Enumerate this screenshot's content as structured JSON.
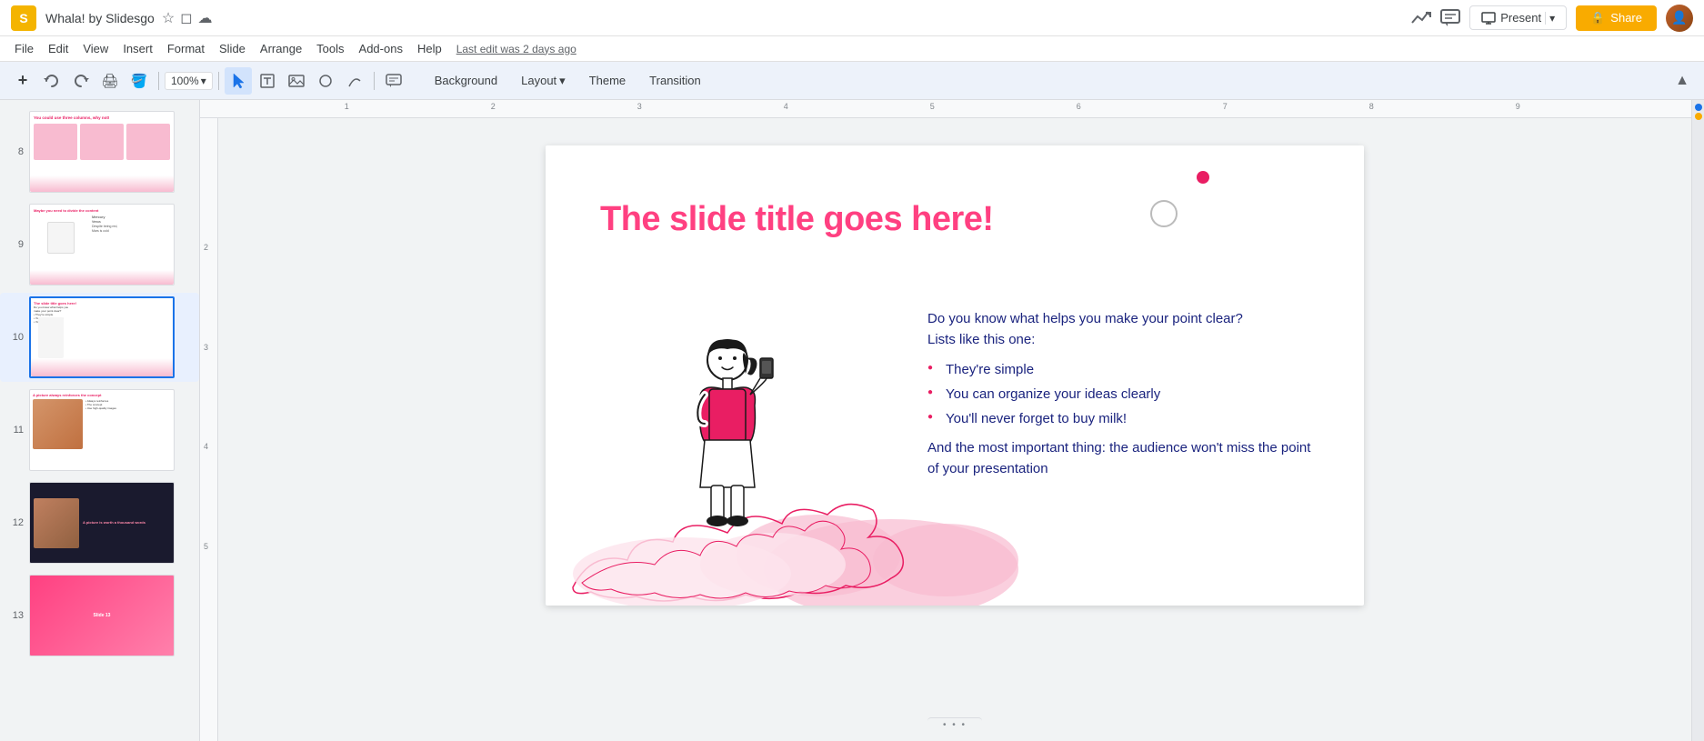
{
  "app": {
    "icon_text": "S",
    "title": "Whala! by Slidesgo",
    "last_edit": "Last edit was 2 days ago"
  },
  "titlebar": {
    "star_icon": "★",
    "folder_icon": "📁",
    "cloud_icon": "☁"
  },
  "titlebar_right": {
    "trend_icon": "📈",
    "comment_icon": "💬",
    "present_label": "Present",
    "present_dropdown": "▾",
    "share_icon": "🔒",
    "share_label": "Share"
  },
  "menu": {
    "items": [
      "File",
      "Edit",
      "View",
      "Insert",
      "Format",
      "Slide",
      "Arrange",
      "Tools",
      "Add-ons",
      "Help"
    ],
    "last_edit": "Last edit was 2 days ago"
  },
  "toolbar": {
    "add_icon": "+",
    "undo_icon": "↩",
    "redo_icon": "↪",
    "print_icon": "🖨",
    "paint_icon": "🪣",
    "zoom_value": "100%",
    "zoom_dropdown": "▾",
    "cursor_icon": "↖",
    "text_icon": "T",
    "image_icon": "🖼",
    "shape_icon": "◯",
    "line_icon": "⌒",
    "comment_icon": "💬",
    "background_label": "Background",
    "layout_label": "Layout",
    "layout_dropdown": "▾",
    "theme_label": "Theme",
    "transition_label": "Transition",
    "collapse_icon": "▲"
  },
  "slides": [
    {
      "num": "8",
      "has_content": true,
      "label": "You could use three columns, why not!"
    },
    {
      "num": "9",
      "has_content": true,
      "label": "Maybe you need to divide the content"
    },
    {
      "num": "10",
      "has_content": true,
      "label": "The slide title goes here!",
      "active": true
    },
    {
      "num": "11",
      "has_content": true,
      "label": "A picture always reinforces the concept"
    },
    {
      "num": "12",
      "has_content": true,
      "label": "A picture is worth a thousand words"
    },
    {
      "num": "13",
      "has_content": true,
      "label": ""
    }
  ],
  "slide": {
    "title": "The slide title goes here!",
    "intro_line1": "Do you know what helps you make your point clear?",
    "intro_line2": "Lists like this one:",
    "bullet1": "They're simple",
    "bullet2": "You can organize your ideas clearly",
    "bullet3": "You'll never forget to buy milk!",
    "outro": "And the most important thing: the audience won't miss the point of your presentation"
  },
  "ruler": {
    "marks": [
      "1",
      "2",
      "3",
      "4",
      "5",
      "6",
      "7",
      "8",
      "9"
    ],
    "vmarks": [
      "2",
      "3",
      "4",
      "5"
    ]
  },
  "bottom_handle": {
    "dots": "• • •"
  }
}
